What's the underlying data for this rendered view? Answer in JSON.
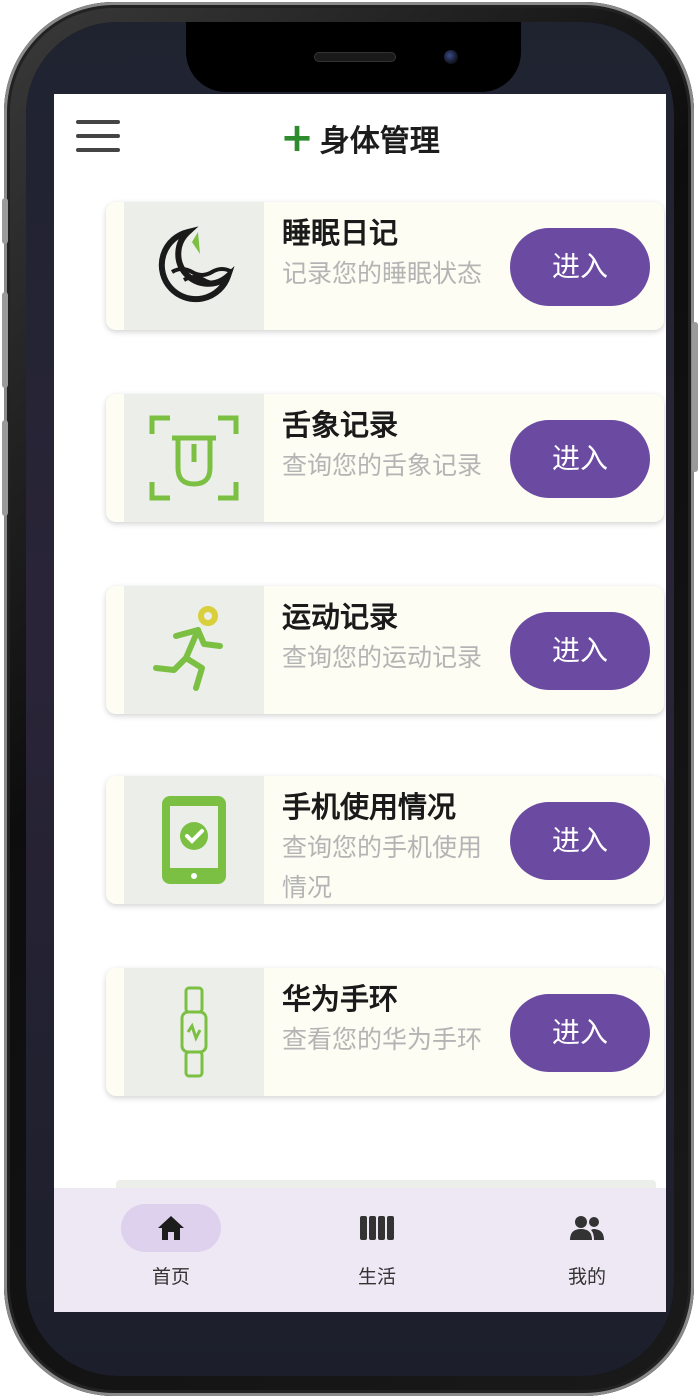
{
  "header": {
    "plus_icon": "plus-icon",
    "title": "身体管理",
    "menu_icon": "hamburger-menu-icon"
  },
  "cards": [
    {
      "title": "睡眠日记",
      "desc": "记录您的睡眠状态",
      "button": "进入",
      "icon": "moon-sleep-icon"
    },
    {
      "title": "舌象记录",
      "desc": "查询您的舌象记录",
      "button": "进入",
      "icon": "tongue-scan-icon"
    },
    {
      "title": "运动记录",
      "desc": "查询您的运动记录",
      "button": "进入",
      "icon": "running-person-icon"
    },
    {
      "title": "手机使用情况",
      "desc": "查询您的手机使用情况",
      "button": "进入",
      "icon": "phone-check-icon"
    },
    {
      "title": "华为手环",
      "desc": "查看您的华为手环",
      "button": "进入",
      "icon": "band-icon"
    }
  ],
  "tabs": [
    {
      "label": "首页",
      "icon": "home-icon",
      "active": true
    },
    {
      "label": "生活",
      "icon": "columns-icon",
      "active": false
    },
    {
      "label": "我的",
      "icon": "people-icon",
      "active": false
    }
  ],
  "colors": {
    "accent": "#6b4aa2",
    "icon_green": "#7bc043",
    "tabbar": "#eee8f5"
  }
}
